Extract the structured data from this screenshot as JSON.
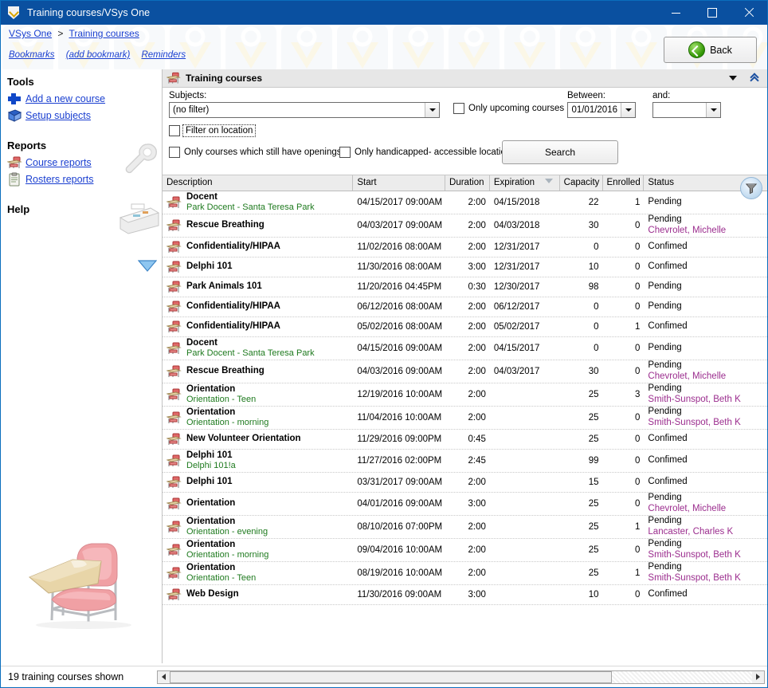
{
  "window": {
    "title": "Training courses/VSys One",
    "app_icon": "shield-icon",
    "minimize": "–",
    "maximize": "□",
    "close": "✕"
  },
  "breadcrumb": {
    "root": "VSys One",
    "separator": ">",
    "current": "Training courses"
  },
  "bookmarks_bar": {
    "bookmarks": "Bookmarks",
    "add_bookmark": "(add bookmark)",
    "reminders": "Reminders"
  },
  "back_button": {
    "label": "Back",
    "icon": "green-back-arrow-icon"
  },
  "sidebar": {
    "tools_heading": "Tools",
    "tools": [
      {
        "label": "Add a new course",
        "icon": "plus-icon"
      },
      {
        "label": "Setup subjects",
        "icon": "blue-book-icon"
      }
    ],
    "reports_heading": "Reports",
    "reports": [
      {
        "label": "Course reports",
        "icon": "desk-icon"
      },
      {
        "label": "Rosters reports",
        "icon": "clipboard-icon"
      }
    ],
    "help_heading": "Help",
    "decorations": [
      "wrench-icon",
      "printer-icon",
      "blue-down-arrow-icon",
      "school-desk-illustration"
    ]
  },
  "panel": {
    "title": "Training courses",
    "icon": "desk-icon",
    "collapse_icon": "triangle-down-icon",
    "expand_icon": "double-chevron-up-icon"
  },
  "filters": {
    "subjects_label": "Subjects:",
    "subjects_value": "(no filter)",
    "only_upcoming_label": "Only upcoming courses",
    "only_upcoming_checked": false,
    "between_label": "Between:",
    "between_value": "01/01/2016",
    "and_label": "and:",
    "and_value": "",
    "filter_on_location_label": "Filter on location",
    "filter_on_location_checked": false,
    "only_openings_label": "Only courses which still have openings",
    "only_openings_checked": false,
    "only_handicapped_label": "Only handicapped- accessible locations",
    "only_handicapped_checked": false,
    "search_label": "Search"
  },
  "grid": {
    "columns": [
      "Description",
      "Start",
      "Duration",
      "Expiration",
      "Capacity",
      "Enrolled",
      "Status"
    ],
    "sorted_column": "Expiration",
    "sort_direction": "descending",
    "filter_button_icon": "funnel-icon",
    "rows": [
      {
        "title": "Docent",
        "sub": "Park Docent - Santa Teresa Park",
        "start": "04/15/2017 09:00AM",
        "duration": "2:00",
        "expiration": "04/15/2018",
        "capacity": "22",
        "enrolled": "1",
        "status": "Pending",
        "instructor": ""
      },
      {
        "title": "Rescue Breathing",
        "sub": "",
        "start": "04/03/2017 09:00AM",
        "duration": "2:00",
        "expiration": "04/03/2018",
        "capacity": "30",
        "enrolled": "0",
        "status": "Pending",
        "instructor": "Chevrolet, Michelle"
      },
      {
        "title": "Confidentiality/HIPAA",
        "sub": "",
        "start": "11/02/2016 08:00AM",
        "duration": "2:00",
        "expiration": "12/31/2017",
        "capacity": "0",
        "enrolled": "0",
        "status": "Confimed",
        "instructor": ""
      },
      {
        "title": "Delphi 101",
        "sub": "",
        "start": "11/30/2016 08:00AM",
        "duration": "3:00",
        "expiration": "12/31/2017",
        "capacity": "10",
        "enrolled": "0",
        "status": "Confimed",
        "instructor": ""
      },
      {
        "title": "Park Animals 101",
        "sub": "",
        "start": "11/20/2016 04:45PM",
        "duration": "0:30",
        "expiration": "12/30/2017",
        "capacity": "98",
        "enrolled": "0",
        "status": "Pending",
        "instructor": ""
      },
      {
        "title": "Confidentiality/HIPAA",
        "sub": "",
        "start": "06/12/2016 08:00AM",
        "duration": "2:00",
        "expiration": "06/12/2017",
        "capacity": "0",
        "enrolled": "0",
        "status": "Pending",
        "instructor": ""
      },
      {
        "title": "Confidentiality/HIPAA",
        "sub": "",
        "start": "05/02/2016 08:00AM",
        "duration": "2:00",
        "expiration": "05/02/2017",
        "capacity": "0",
        "enrolled": "1",
        "status": "Confimed",
        "instructor": ""
      },
      {
        "title": "Docent",
        "sub": "Park Docent - Santa Teresa Park",
        "start": "04/15/2016 09:00AM",
        "duration": "2:00",
        "expiration": "04/15/2017",
        "capacity": "0",
        "enrolled": "0",
        "status": "Pending",
        "instructor": ""
      },
      {
        "title": "Rescue Breathing",
        "sub": "",
        "start": "04/03/2016 09:00AM",
        "duration": "2:00",
        "expiration": "04/03/2017",
        "capacity": "30",
        "enrolled": "0",
        "status": "Pending",
        "instructor": "Chevrolet, Michelle"
      },
      {
        "title": "Orientation",
        "sub": "Orientation - Teen",
        "start": "12/19/2016 10:00AM",
        "duration": "2:00",
        "expiration": "",
        "capacity": "25",
        "enrolled": "3",
        "status": "Pending",
        "instructor": "Smith-Sunspot, Beth K"
      },
      {
        "title": "Orientation",
        "sub": "Orientation - morning",
        "start": "11/04/2016 10:00AM",
        "duration": "2:00",
        "expiration": "",
        "capacity": "25",
        "enrolled": "0",
        "status": "Pending",
        "instructor": "Smith-Sunspot, Beth K"
      },
      {
        "title": "New Volunteer Orientation",
        "sub": "",
        "start": "11/29/2016 09:00PM",
        "duration": "0:45",
        "expiration": "",
        "capacity": "25",
        "enrolled": "0",
        "status": "Confimed",
        "instructor": ""
      },
      {
        "title": "Delphi 101",
        "sub": "Delphi 101!a",
        "start": "11/27/2016 02:00PM",
        "duration": "2:45",
        "expiration": "",
        "capacity": "99",
        "enrolled": "0",
        "status": "Confimed",
        "instructor": ""
      },
      {
        "title": "Delphi 101",
        "sub": "",
        "start": "03/31/2017 09:00AM",
        "duration": "2:00",
        "expiration": "",
        "capacity": "15",
        "enrolled": "0",
        "status": "Confimed",
        "instructor": ""
      },
      {
        "title": "Orientation",
        "sub": "",
        "start": "04/01/2016 09:00AM",
        "duration": "3:00",
        "expiration": "",
        "capacity": "25",
        "enrolled": "0",
        "status": "Pending",
        "instructor": "Chevrolet, Michelle"
      },
      {
        "title": "Orientation",
        "sub": "Orientation - evening",
        "start": "08/10/2016 07:00PM",
        "duration": "2:00",
        "expiration": "",
        "capacity": "25",
        "enrolled": "1",
        "status": "Pending",
        "instructor": "Lancaster, Charles K"
      },
      {
        "title": "Orientation",
        "sub": "Orientation - morning",
        "start": "09/04/2016 10:00AM",
        "duration": "2:00",
        "expiration": "",
        "capacity": "25",
        "enrolled": "0",
        "status": "Pending",
        "instructor": "Smith-Sunspot, Beth K"
      },
      {
        "title": "Orientation",
        "sub": "Orientation - Teen",
        "start": "08/19/2016 10:00AM",
        "duration": "2:00",
        "expiration": "",
        "capacity": "25",
        "enrolled": "1",
        "status": "Pending",
        "instructor": "Smith-Sunspot, Beth K"
      },
      {
        "title": "Web Design",
        "sub": "",
        "start": "11/30/2016 09:00AM",
        "duration": "3:00",
        "expiration": "",
        "capacity": "10",
        "enrolled": "0",
        "status": "Confimed",
        "instructor": ""
      }
    ]
  },
  "statusbar": {
    "count_text": "19 training courses shown",
    "scroll_left_icon": "arrow-left-icon",
    "scroll_right_icon": "arrow-right-icon"
  },
  "colors": {
    "titlebar": "#0a50a0",
    "link": "#1a3fd0",
    "subtitle_green": "#1e7a1e",
    "instructor_purple": "#9b2d8e",
    "panel_header": "#e7e7e7"
  }
}
